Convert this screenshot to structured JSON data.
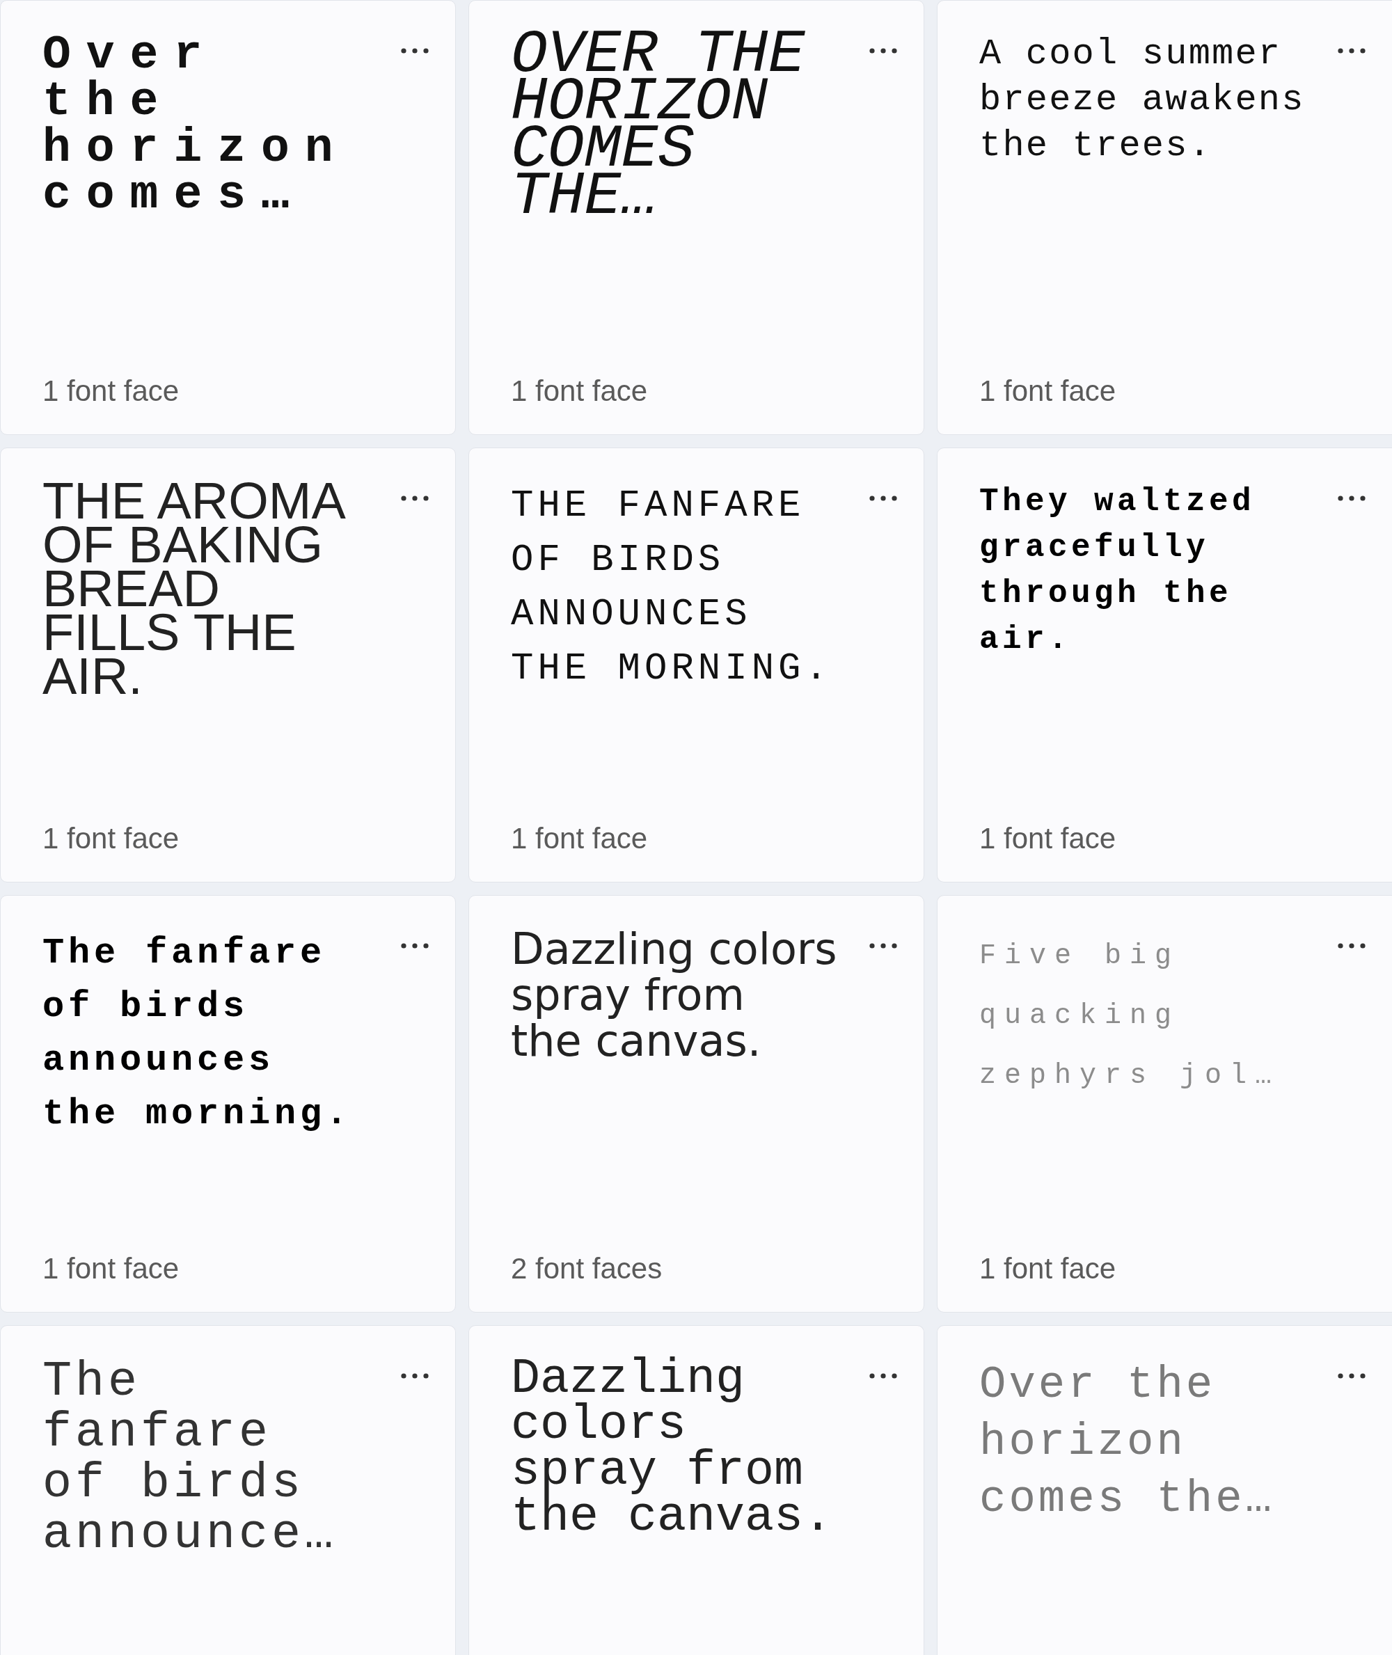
{
  "font_cards": [
    {
      "preview": "Over the horizon comes…",
      "face_count": "1 font face"
    },
    {
      "preview": "OVER THE HORIZON COMES THE…",
      "face_count": "1 font face"
    },
    {
      "preview": "A cool summer breeze awakens the trees.",
      "face_count": "1 font face"
    },
    {
      "preview": "THE AROMA OF BAKING BREAD FILLS THE AIR.",
      "face_count": "1 font face"
    },
    {
      "preview": "THE FANFARE OF BIRDS ANNOUNCES THE MORNING.",
      "face_count": "1 font face"
    },
    {
      "preview": "They waltzed gracefully through the air.",
      "face_count": "1 font face"
    },
    {
      "preview": "The fanfare of birds announces the morning.",
      "face_count": "1 font face"
    },
    {
      "preview": "Dazzling colors spray from the canvas.",
      "face_count": "2 font faces"
    },
    {
      "preview": "Five big quacking zephyrs jol…",
      "face_count": "1 font face"
    },
    {
      "preview": "The fanfare of birds announce…"
    },
    {
      "preview": "Dazzling colors spray from the canvas."
    },
    {
      "preview": "Over the horizon comes the…"
    }
  ]
}
